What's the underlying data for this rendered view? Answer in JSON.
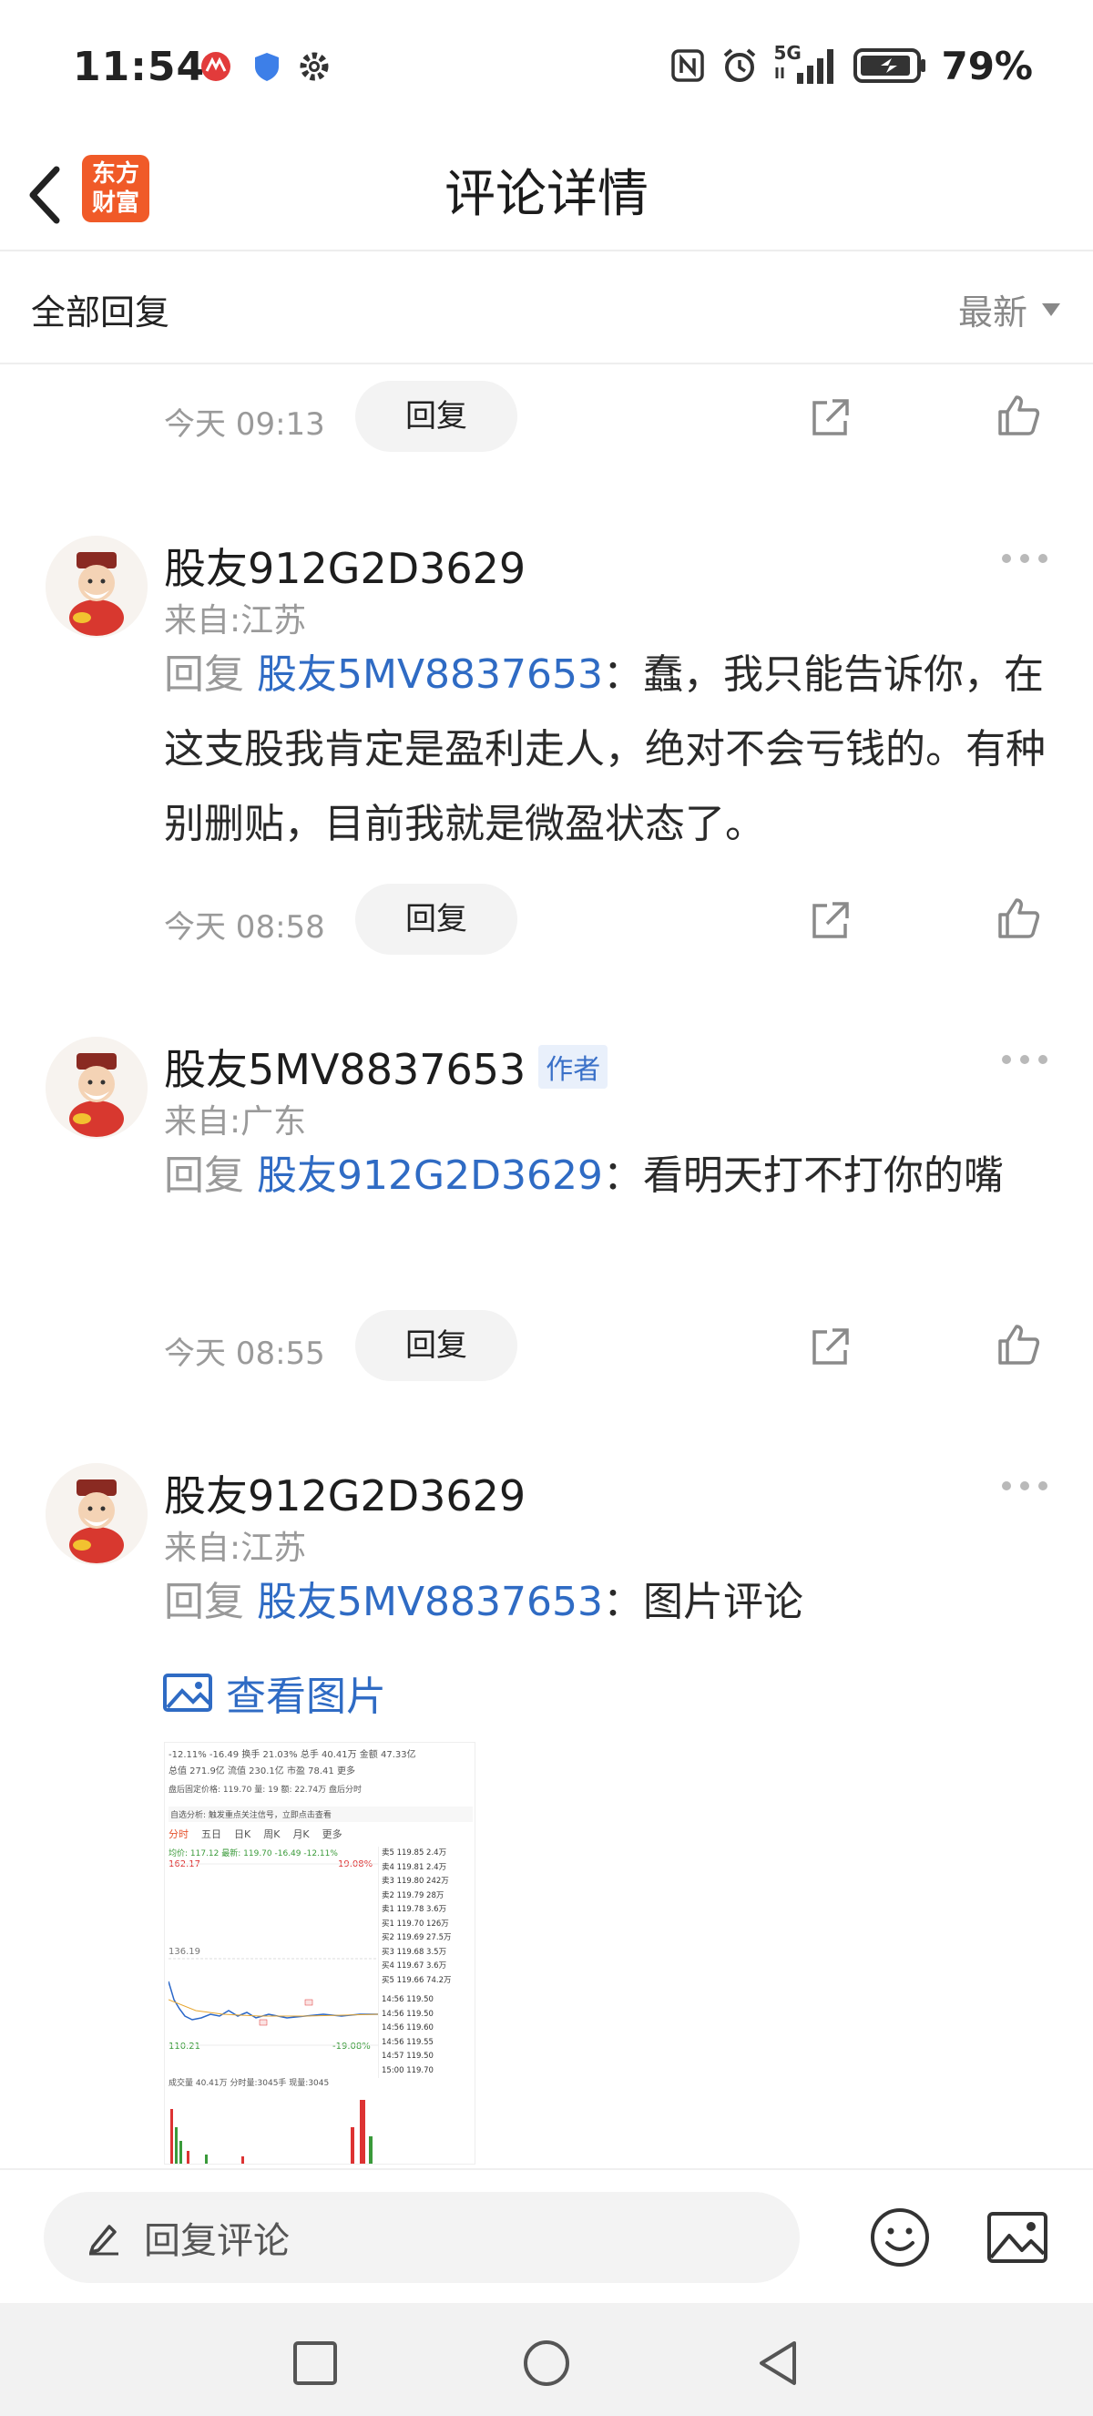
{
  "status_bar": {
    "time": "11:54",
    "network": "5G",
    "battery": "79%",
    "icons": [
      "unionpay-icon",
      "shield-icon",
      "gear-icon",
      "nfc-icon",
      "alarm-icon",
      "signal-icon",
      "battery-icon"
    ]
  },
  "header": {
    "logo_line1": "东方",
    "logo_line2": "财富",
    "title": "评论详情"
  },
  "filter": {
    "label": "全部回复",
    "sort": "最新"
  },
  "first_actions": {
    "time": "今天 09:13",
    "reply_label": "回复"
  },
  "comments": [
    {
      "user": "股友912G2D3629",
      "badge": "",
      "location": "来自:江苏",
      "reply_prefix": "回复",
      "mention": "股友5MV8837653",
      "text": "：蠢，我只能告诉你，在这支股我肯定是盈利走人，绝对不会亏钱的。有种别删贴，目前我就是微盈状态了。",
      "time": "今天 08:58",
      "reply_label": "回复"
    },
    {
      "user": "股友5MV8837653",
      "badge": "作者",
      "location": "来自:广东",
      "reply_prefix": "回复",
      "mention": "股友912G2D3629",
      "text": "：看明天打不打你的嘴",
      "time": "今天 08:55",
      "reply_label": "回复"
    },
    {
      "user": "股友912G2D3629",
      "badge": "",
      "location": "来自:江苏",
      "reply_prefix": "回复",
      "mention": "股友5MV8837653",
      "text": "：图片评论",
      "view_image": "查看图片"
    }
  ],
  "thumbnail": {
    "line1": "-12.11%  -16.49  换手 21.03%  总手 40.41万  金额 47.33亿",
    "line2": "总值 271.9亿  流值 230.1亿  市盈 78.41  更多",
    "line3": "盘后固定价格: 119.70  量: 19  额: 22.74万  盘后分时",
    "line4": "自选分析: 触发重点关注信号，立即点击查看",
    "tabs": [
      "分时",
      "五日",
      "日K",
      "周K",
      "月K",
      "更多"
    ],
    "price_line": "均价: 117.12 最新: 119.70 -16.49 -12.11%",
    "high": "162.17",
    "high_pct": "19.08%",
    "mid": "136.19",
    "low": "110.21",
    "low_pct": "-19.08%",
    "vol_line": "成交量 40.41万  分时量:3045手  现量:3045",
    "book": [
      "卖5 119.85 2.4万",
      "卖4 119.81 2.4万",
      "卖3 119.80 242万",
      "卖2 119.79 28万",
      "卖1 119.78 3.6万",
      "买1 119.70 126万",
      "买2 119.69 27.5万",
      "买3 119.68 3.5万",
      "买4 119.67 3.6万",
      "买5 119.66 74.2万"
    ],
    "trades": [
      "14:56 119.50",
      "14:56 119.50",
      "14:56 119.60",
      "14:56 119.55",
      "14:57 119.50",
      "15:00 119.70"
    ]
  },
  "bottom_bar": {
    "placeholder": "回复评论"
  }
}
